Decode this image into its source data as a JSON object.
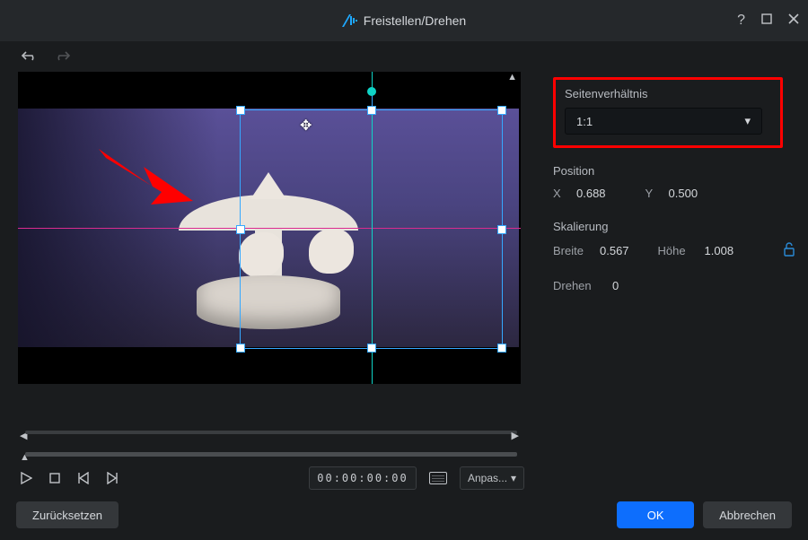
{
  "titlebar": {
    "title": "Freistellen/Drehen"
  },
  "transport": {
    "timecode": "00:00:00:00",
    "fit_label": "Anpas..."
  },
  "panel": {
    "aspect": {
      "label": "Seitenverhältnis",
      "value": "1:1"
    },
    "position": {
      "label": "Position",
      "x_label": "X",
      "x_value": "0.688",
      "y_label": "Y",
      "y_value": "0.500"
    },
    "scale": {
      "label": "Skalierung",
      "w_label": "Breite",
      "w_value": "0.567",
      "h_label": "Höhe",
      "h_value": "1.008"
    },
    "rotate": {
      "label": "Drehen",
      "value": "0"
    }
  },
  "footer": {
    "reset": "Zurücksetzen",
    "ok": "OK",
    "cancel": "Abbrechen"
  }
}
